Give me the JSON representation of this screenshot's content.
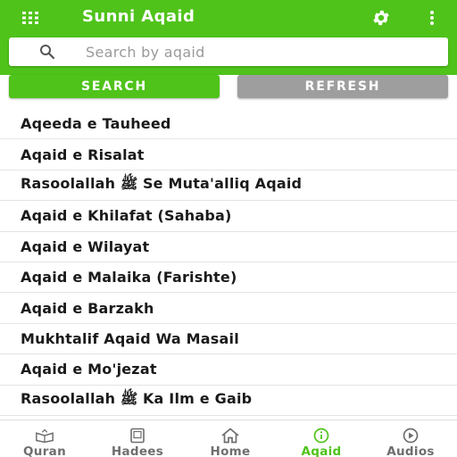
{
  "app_bar": {
    "title": "Sunni Aqaid",
    "menu_icon": "grid-menu-icon",
    "settings_icon": "gear-icon",
    "more_icon": "more-vertical-icon"
  },
  "search": {
    "placeholder": "Search by aqaid",
    "value": ""
  },
  "buttons": {
    "search_label": "SEARCH",
    "refresh_label": "REFRESH"
  },
  "items": [
    {
      "label": "Aqeeda e Tauheed"
    },
    {
      "label": "Aqaid e Risalat"
    },
    {
      "label": "Rasoolallah ﷺ Se Muta'alliq Aqaid"
    },
    {
      "label": "Aqaid e Khilafat (Sahaba)"
    },
    {
      "label": "Aqaid e Wilayat"
    },
    {
      "label": "Aqaid e Malaika (Farishte)"
    },
    {
      "label": "Aqaid e Barzakh"
    },
    {
      "label": "Mukhtalif Aqaid Wa Masail"
    },
    {
      "label": "Aqaid e Mo'jezat"
    },
    {
      "label": "Rasoolallah ﷺ Ka Ilm e Gaib"
    }
  ],
  "bottom_nav": {
    "active": "Aqaid",
    "tabs": [
      {
        "label": "Quran",
        "icon": "quran-book-icon"
      },
      {
        "label": "Hadees",
        "icon": "hadees-book-icon"
      },
      {
        "label": "Home",
        "icon": "home-icon"
      },
      {
        "label": "Aqaid",
        "icon": "info-circle-icon"
      },
      {
        "label": "Audios",
        "icon": "play-circle-icon"
      }
    ]
  },
  "colors": {
    "primary": "#4fc31a",
    "refresh_button": "#9e9e9e",
    "inactive_nav": "#6e6e6e"
  }
}
